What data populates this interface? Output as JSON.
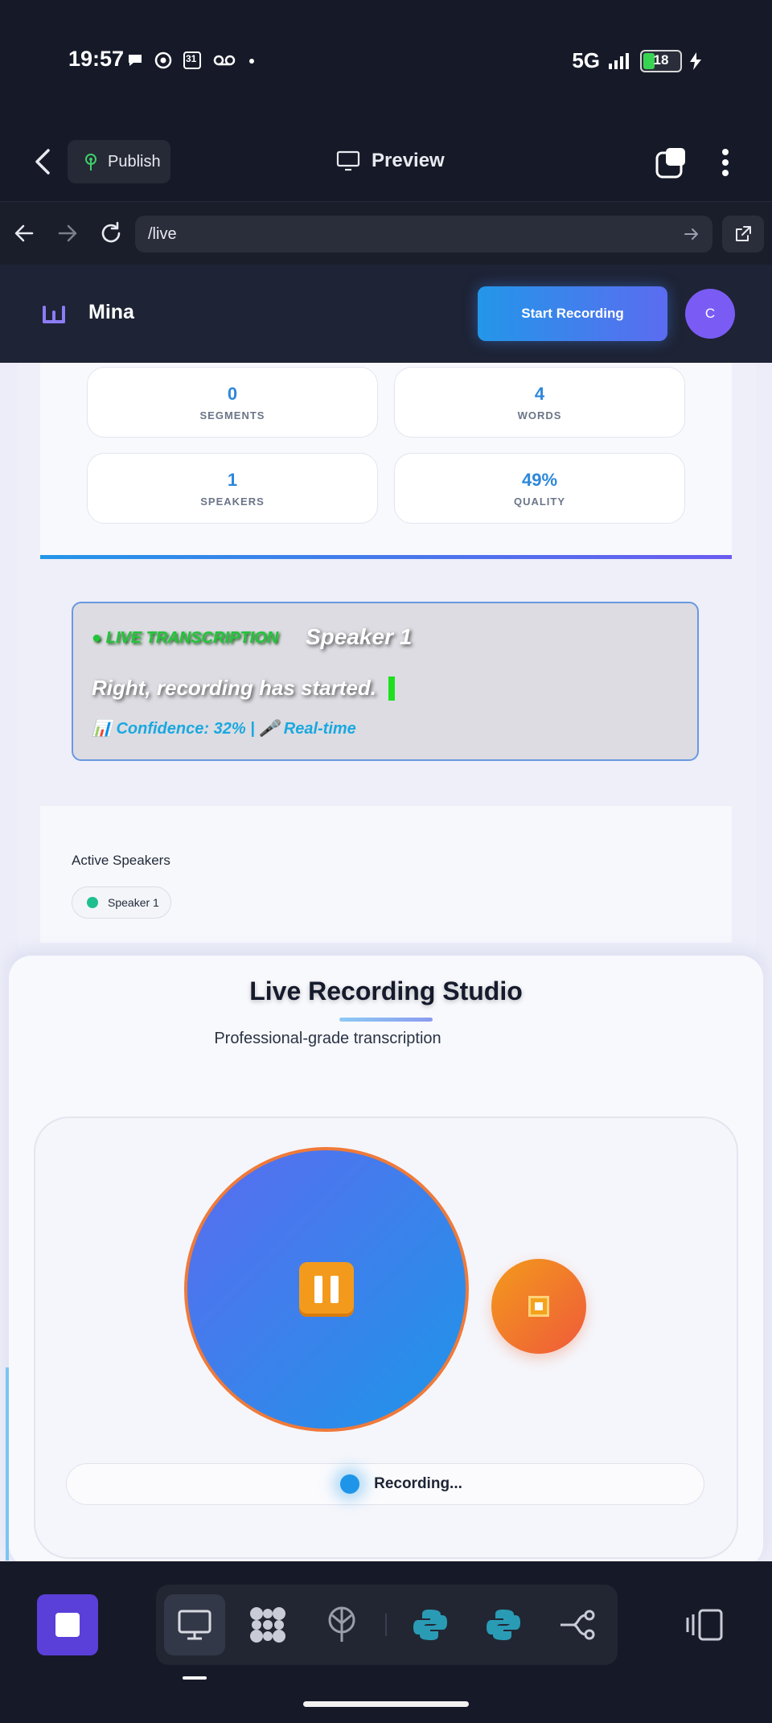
{
  "status_bar": {
    "time": "19:57",
    "calendar_day": "31",
    "network": "5G",
    "battery": "18"
  },
  "app_bar": {
    "publish_label": "Publish",
    "preview_label": "Preview"
  },
  "url_bar": {
    "path": "/live"
  },
  "app_header": {
    "brand": "Mina",
    "start_recording": "Start Recording",
    "avatar_letter": "C"
  },
  "stats": [
    {
      "value": "0",
      "label": "SEGMENTS"
    },
    {
      "value": "4",
      "label": "WORDS"
    },
    {
      "value": "1",
      "label": "SPEAKERS"
    },
    {
      "value": "49%",
      "label": "QUALITY"
    }
  ],
  "live": {
    "tag": "● LIVE TRANSCRIPTION",
    "speaker": "Speaker 1",
    "text": "Right, recording has started.",
    "confidence": "📊 Confidence: 32% | 🎤 Real-time"
  },
  "speakers": {
    "title": "Active Speakers",
    "items": [
      {
        "name": "Speaker 1",
        "color": "#1fbf8f"
      }
    ]
  },
  "studio": {
    "title": "Live Recording Studio",
    "subtitle": "Professional-grade transcription",
    "status": "Recording..."
  },
  "colors": {
    "accent": "#2396e8",
    "accent2": "#5b6cf0",
    "stop": "#ef5a3a",
    "pause_frame": "#f39a1c"
  },
  "bottom_tools": [
    "monitor-icon",
    "apps-icon",
    "antenna-icon",
    "python-icon",
    "python-icon",
    "branch-icon",
    "sidebar-icon"
  ]
}
